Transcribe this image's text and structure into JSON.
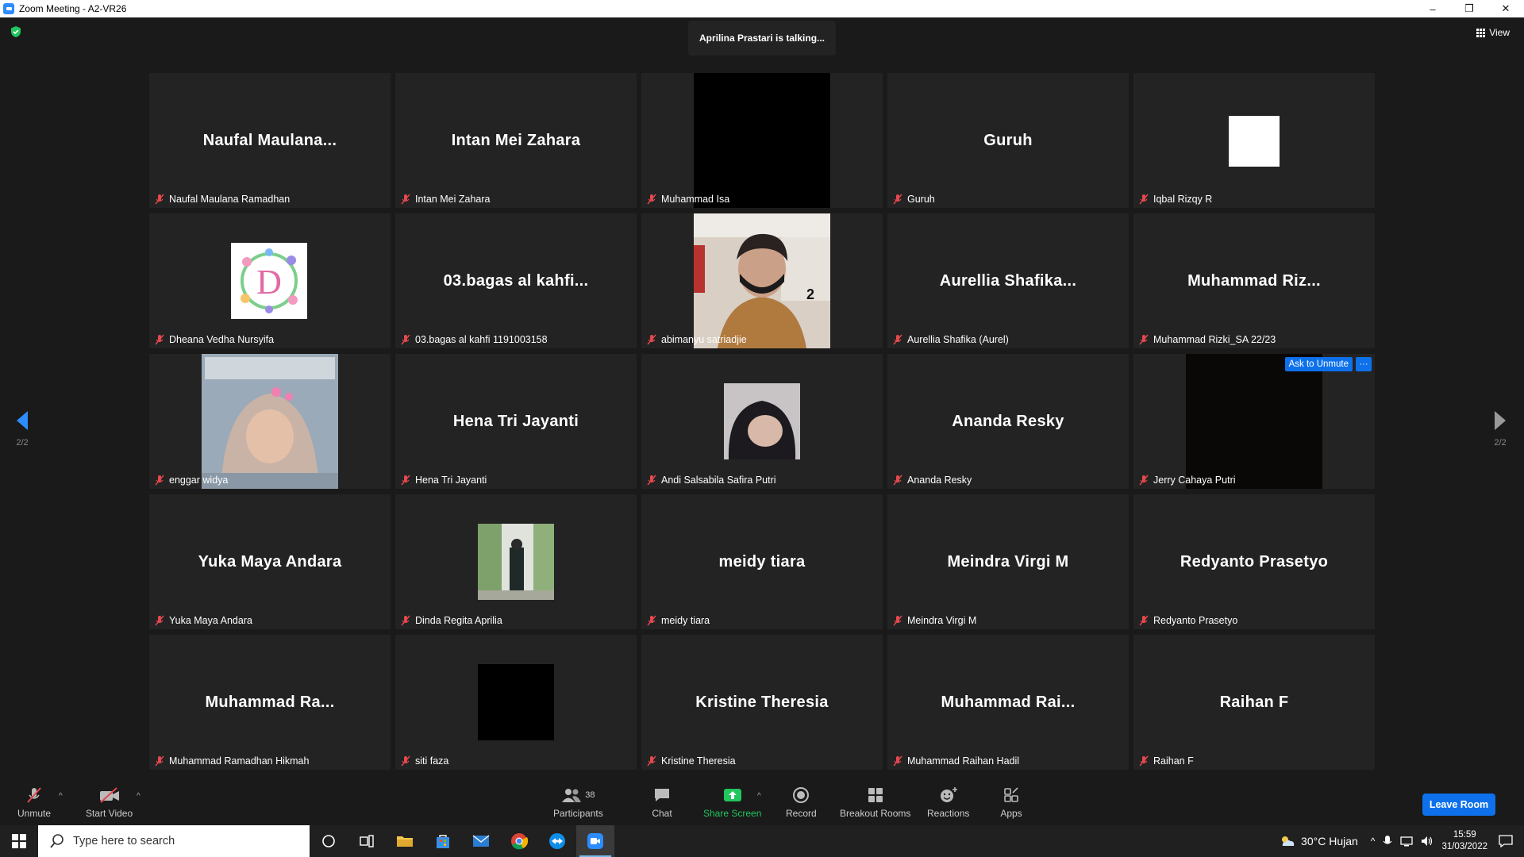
{
  "window": {
    "title": "Zoom Meeting - A2-VR26",
    "controls": [
      "–",
      "❐",
      "✕"
    ]
  },
  "meeting": {
    "talking_indicator": "Aprilina Prastari is talking...",
    "view_label": "View",
    "page_indicator_left": "2/2",
    "page_indicator_right": "2/2",
    "ask_to_unmute": "Ask to Unmute",
    "more": "···"
  },
  "participants": [
    {
      "display": "Naufal  Maulana...",
      "label": "Naufal Maulana Ramadhan",
      "video": "name"
    },
    {
      "display": "Intan Mei Zahara",
      "label": "Intan Mei Zahara",
      "video": "name"
    },
    {
      "display": "",
      "label": "Muhammad Isa",
      "video": "black"
    },
    {
      "display": "Guruh",
      "label": "Guruh",
      "video": "name"
    },
    {
      "display": "",
      "label": "Iqbal Rizqy R",
      "video": "white-square"
    },
    {
      "display": "",
      "label": "Dheana Vedha Nursyifa",
      "video": "floral-D"
    },
    {
      "display": "03.bagas al kahfi...",
      "label": "03.bagas al kahfi 1191003158",
      "video": "name"
    },
    {
      "display": "",
      "label": "abimanyu satriadjie",
      "video": "person-mask"
    },
    {
      "display": "Aurellia  Shafika...",
      "label": "Aurellia Shafika (Aurel)",
      "video": "name"
    },
    {
      "display": "Muhammad  Riz...",
      "label": "Muhammad Rizki_SA 22/23",
      "video": "name"
    },
    {
      "display": "",
      "label": "enggar widya",
      "video": "hijab-selfie"
    },
    {
      "display": "Hena Tri Jayanti",
      "label": "Hena Tri Jayanti",
      "video": "name"
    },
    {
      "display": "",
      "label": "Andi Salsabila Safira Putri",
      "video": "hijab-small"
    },
    {
      "display": "Ananda Resky",
      "label": "Ananda Resky",
      "video": "name"
    },
    {
      "display": "",
      "label": "Jerry Cahaya Putri",
      "video": "dark"
    },
    {
      "display": "Yuka Maya Andara",
      "label": "Yuka Maya Andara",
      "video": "name"
    },
    {
      "display": "",
      "label": "Dinda Regita Aprilia",
      "video": "plants"
    },
    {
      "display": "meidy tiara",
      "label": "meidy tiara",
      "video": "name"
    },
    {
      "display": "Meindra Virgi M",
      "label": "Meindra Virgi M",
      "video": "name"
    },
    {
      "display": "Redyanto Prasetyo",
      "label": "Redyanto Prasetyo",
      "video": "name"
    },
    {
      "display": "Muhammad  Ra...",
      "label": "Muhammad Ramadhan Hikmah",
      "video": "name"
    },
    {
      "display": "",
      "label": "siti faza",
      "video": "black-small"
    },
    {
      "display": "Kristine Theresia",
      "label": "Kristine Theresia",
      "video": "name"
    },
    {
      "display": "Muhammad  Rai...",
      "label": "Muhammad Raihan Hadil",
      "video": "name"
    },
    {
      "display": "Raihan F",
      "label": "Raihan F",
      "video": "name"
    }
  ],
  "photo_overlay_number": "2",
  "toolbar": {
    "unmute": "Unmute",
    "start_video": "Start Video",
    "participants": "Participants",
    "participants_count": "38",
    "chat": "Chat",
    "share_screen": "Share Screen",
    "record": "Record",
    "breakout_rooms": "Breakout Rooms",
    "reactions": "Reactions",
    "apps": "Apps",
    "leave": "Leave Room"
  },
  "taskbar": {
    "search_placeholder": "Type here to search",
    "weather": "30°C  Hujan",
    "time": "15:59",
    "date": "31/03/2022"
  },
  "colors": {
    "accent": "#0e71eb",
    "share_green": "#22c55e",
    "muted_red": "#e5484d"
  }
}
